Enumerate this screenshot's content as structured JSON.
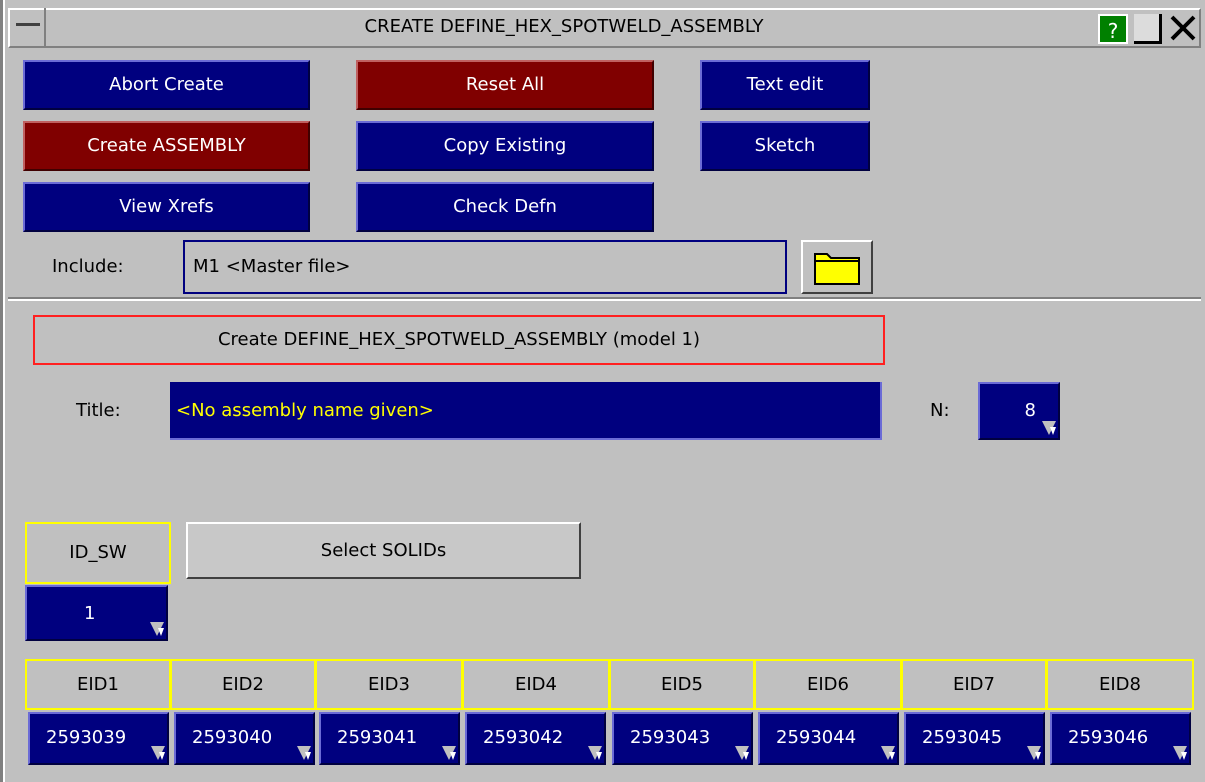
{
  "window": {
    "title": "CREATE DEFINE_HEX_SPOTWELD_ASSEMBLY",
    "help_label": "?",
    "close_label": "✕"
  },
  "toolbar": {
    "abort_create": "Abort Create",
    "reset_all": "Reset All",
    "text_edit": "Text edit",
    "create_assembly": "Create ASSEMBLY",
    "copy_existing": "Copy Existing",
    "sketch": "Sketch",
    "view_xrefs": "View Xrefs",
    "check_defn": "Check Defn"
  },
  "include": {
    "label": "Include:",
    "value": "M1  <Master file>"
  },
  "form": {
    "header": "Create DEFINE_HEX_SPOTWELD_ASSEMBLY (model 1)",
    "title_label": "Title:",
    "title_value": "<No assembly name given>",
    "n_label": "N:",
    "n_value": "8"
  },
  "id_sw": {
    "label": "ID_SW",
    "value": "1",
    "select_solids": "Select SOLIDs"
  },
  "eids": {
    "headers": [
      "EID1",
      "EID2",
      "EID3",
      "EID4",
      "EID5",
      "EID6",
      "EID7",
      "EID8"
    ],
    "values": [
      "2593039",
      "2593040",
      "2593041",
      "2593042",
      "2593043",
      "2593044",
      "2593045",
      "2593046"
    ]
  },
  "colors": {
    "panel_bg": "#c0c0c0",
    "button_blue": "#00007f",
    "button_red": "#800000",
    "title_text_yellow": "#ffff00",
    "header_border_red": "#ff2020",
    "cell_border_yellow": "#ffff00",
    "help_green": "#008000",
    "folder_yellow": "#ffff00"
  },
  "icons": {
    "folder": "folder-icon",
    "dropdown_corner": "dropdown-corner-icon",
    "system_menu": "system-menu-icon"
  }
}
